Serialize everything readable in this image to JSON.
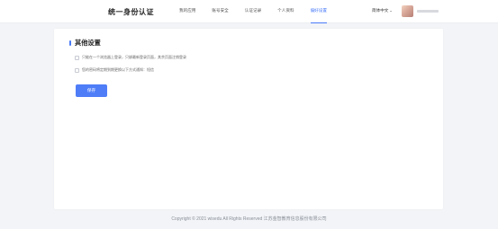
{
  "header": {
    "brand": "统一身份认证",
    "nav": [
      {
        "label": "我的应用"
      },
      {
        "label": "账号安全"
      },
      {
        "label": "认证记录"
      },
      {
        "label": "个人资料"
      },
      {
        "label": "偏好设置"
      }
    ],
    "active_nav": "偏好设置",
    "language": "简体中文",
    "language_arrow": "⌄"
  },
  "settings": {
    "section_title": "其他设置",
    "options": [
      {
        "label": "只能在一个浏览器上登录，只绑最新登录页面，其余页面注销登录",
        "checked": false
      },
      {
        "label": "您的密码将定期到期更换以下方式通知：短信",
        "checked": false
      }
    ],
    "save_label": "保存"
  },
  "footer": {
    "copyright": "Copyright © 2021 wisedu All Rights Reserved 江苏金智教育信息股份有限公司"
  },
  "colors": {
    "accent": "#4a7bf7",
    "page_bg": "#f2f4f7",
    "card_bg": "#ffffff"
  }
}
